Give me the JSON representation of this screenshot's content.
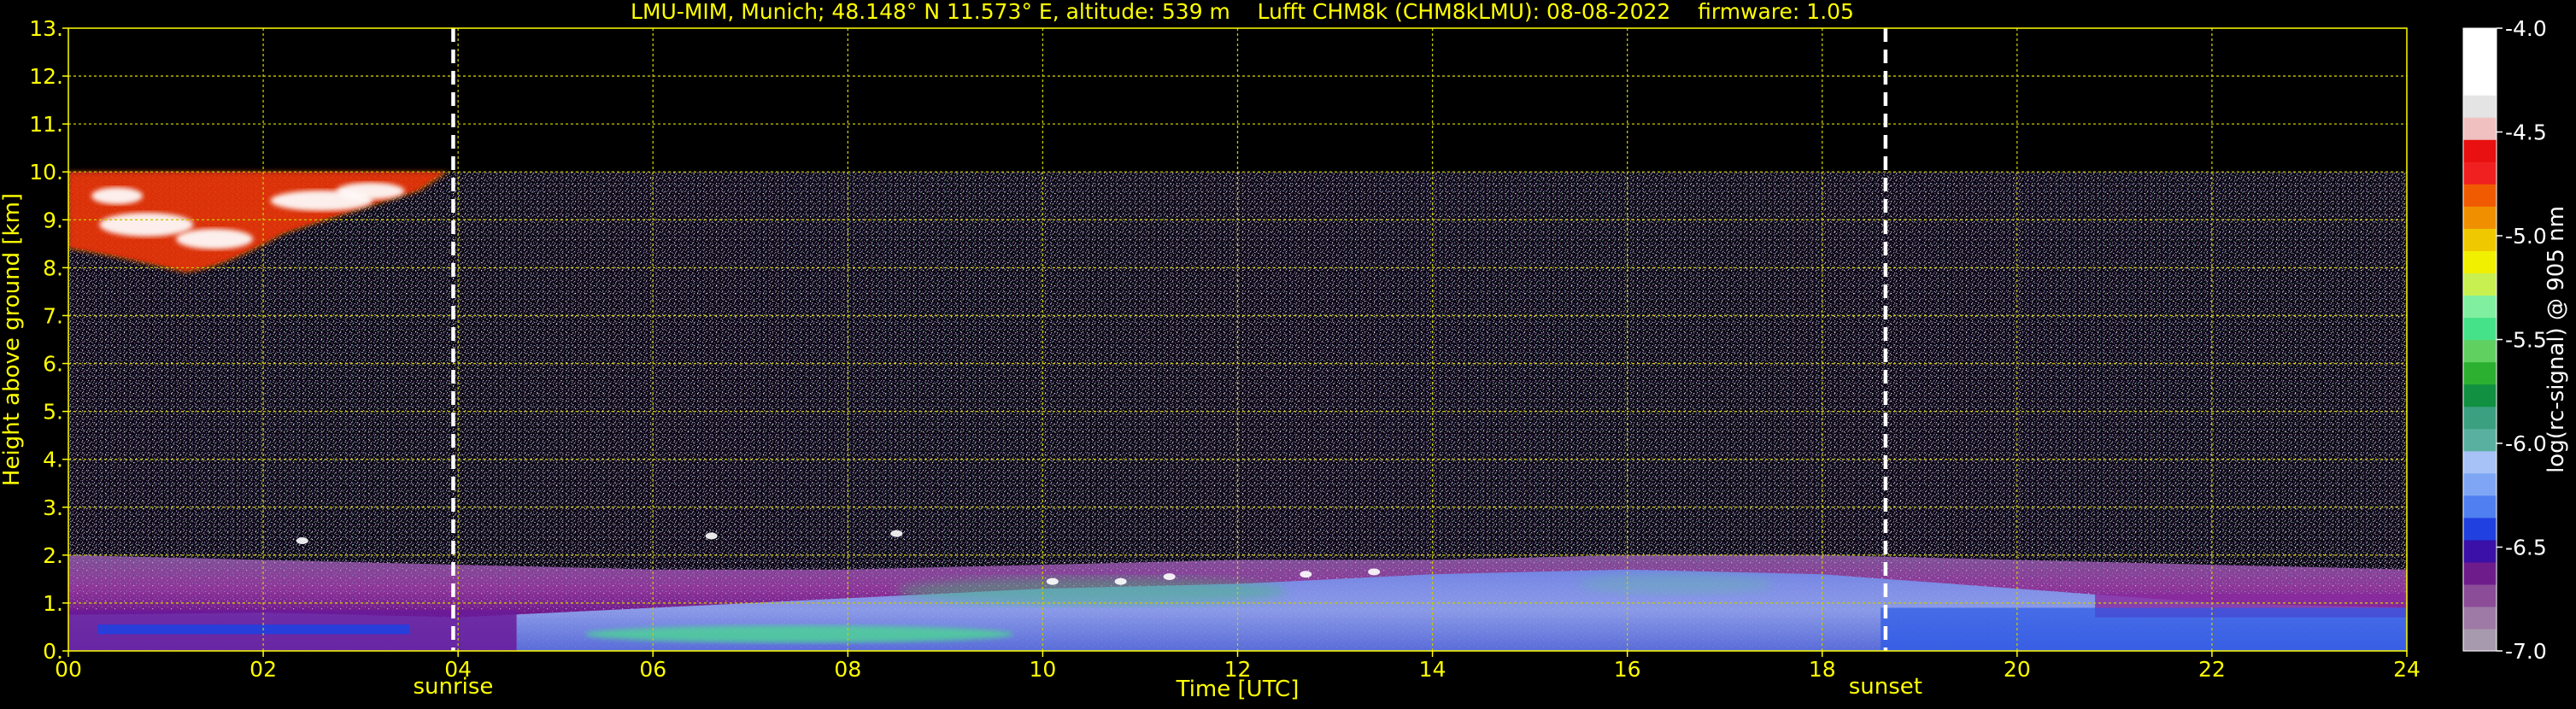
{
  "chart_data": {
    "type": "heatmap",
    "title": "LMU-MIM, Munich; 48.148° N 11.573° E, altitude: 539 m    Lufft CHM8k (CHM8kLMU): 08-08-2022    firmware: 1.05",
    "xlabel": "Time [UTC]",
    "ylabel": "Height above ground [km]",
    "xlim": [
      0,
      24
    ],
    "ylim": [
      0,
      13
    ],
    "x_ticks": [
      "00",
      "02",
      "04",
      "06",
      "08",
      "10",
      "12",
      "14",
      "16",
      "18",
      "20",
      "22",
      "24"
    ],
    "x_tick_values": [
      0,
      2,
      4,
      6,
      8,
      10,
      12,
      14,
      16,
      18,
      20,
      22,
      24
    ],
    "y_ticks": [
      "0.",
      "1.",
      "2.",
      "3.",
      "4.",
      "5.",
      "6.",
      "7.",
      "8.",
      "9.",
      "10.",
      "11.",
      "12.",
      "13."
    ],
    "y_tick_values": [
      0,
      1,
      2,
      3,
      4,
      5,
      6,
      7,
      8,
      9,
      10,
      11,
      12,
      13
    ],
    "grid": true,
    "signal_max_height_km": 10,
    "events": [
      {
        "label": "sunrise",
        "time": 3.95
      },
      {
        "label": "sunset",
        "time": 18.65
      }
    ],
    "layers": [
      {
        "name": "boundary-layer",
        "start": 0,
        "end": 24,
        "top_km": [
          2.0,
          1.9,
          1.8,
          1.7,
          1.7,
          1.8,
          1.9,
          1.9,
          2.0,
          2.0,
          1.9,
          1.8,
          1.7
        ],
        "note_log": -6.3
      },
      {
        "name": "cirrus",
        "start": 0,
        "end": 3.9,
        "base_km": 7.9,
        "top_km": 10.0,
        "note_log": -4.3
      }
    ],
    "colorbar": {
      "label": "log(rc-signal) @ 905 nm",
      "min": -7.0,
      "max": -4.0,
      "ticks": [
        "-4.0",
        "-4.5",
        "-5.0",
        "-5.5",
        "-6.0",
        "-6.5",
        "-7.0"
      ],
      "tick_values": [
        -4.0,
        -4.5,
        -5.0,
        -5.5,
        -6.0,
        -6.5,
        -7.0
      ],
      "colors": [
        "#a89aae",
        "#9e7aa6",
        "#8b4c98",
        "#6e1c8c",
        "#3a10a8",
        "#2040e0",
        "#4f7ff0",
        "#7ea6f4",
        "#a6c2f6",
        "#5ab0a0",
        "#3aa080",
        "#109040",
        "#2cb030",
        "#60d060",
        "#46e28a",
        "#80f0a0",
        "#c8f050",
        "#f0f000",
        "#f0c800",
        "#f09000",
        "#f05a00",
        "#f02020",
        "#e81010",
        "#f0c0c0",
        "#e4e4e4",
        "#ffffff",
        "#ffffff",
        "#ffffff"
      ]
    }
  },
  "colors": {
    "background": "#000000",
    "text": "#ffff00",
    "grid": "#c8c800",
    "event_line": "#ffffff"
  }
}
